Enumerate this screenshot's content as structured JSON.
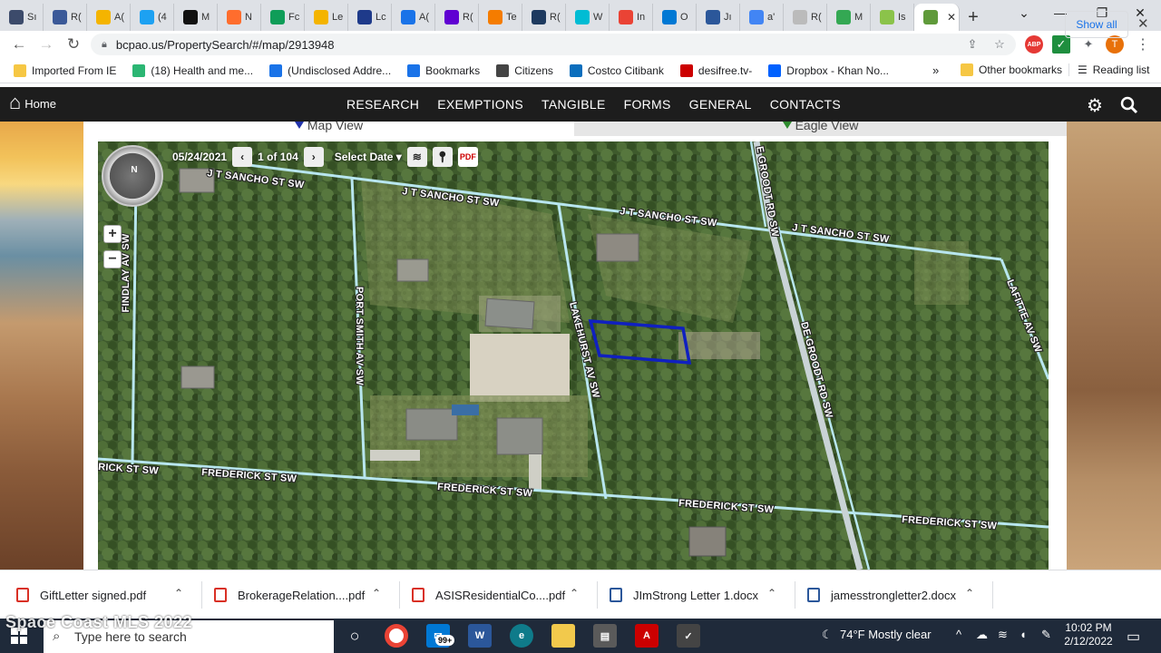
{
  "tabs": [
    {
      "label": "Sı",
      "color": "#3c4b6b"
    },
    {
      "label": "R(",
      "color": "#3b5998"
    },
    {
      "label": "A(",
      "color": "#f4b400"
    },
    {
      "label": "(4",
      "color": "#1da1f2"
    },
    {
      "label": "M",
      "color": "#111111"
    },
    {
      "label": "N",
      "color": "#ff6d2d"
    },
    {
      "label": "Fc",
      "color": "#0f9d58"
    },
    {
      "label": "Le",
      "color": "#f4b400"
    },
    {
      "label": "Lc",
      "color": "#1e3a8a"
    },
    {
      "label": "A(",
      "color": "#1a73e8"
    },
    {
      "label": "R(",
      "color": "#6001d2"
    },
    {
      "label": "Te",
      "color": "#f57c00"
    },
    {
      "label": "R(",
      "color": "#1e3a5f"
    },
    {
      "label": "W",
      "color": "#00bcd4"
    },
    {
      "label": "In",
      "color": "#ea4335"
    },
    {
      "label": "O",
      "color": "#0078d4"
    },
    {
      "label": "Jı",
      "color": "#2b579a"
    },
    {
      "label": "a'",
      "color": "#4285f4"
    },
    {
      "label": "R(",
      "color": "#bbbbbb"
    },
    {
      "label": "M",
      "color": "#34a853"
    },
    {
      "label": "Is",
      "color": "#8bc34a"
    },
    {
      "label": "",
      "color": "#5f9a3a"
    }
  ],
  "address": {
    "url": "bcpao.us/PropertySearch/#/map/2913948"
  },
  "profile_initial": "T",
  "bookmarks": [
    {
      "label": "Imported From IE",
      "color": "#f6c744"
    },
    {
      "label": "(18) Health and me...",
      "color": "#2bb673"
    },
    {
      "label": "(Undisclosed Addre...",
      "color": "#1a73e8"
    },
    {
      "label": "Bookmarks",
      "color": "#1a73e8"
    },
    {
      "label": "Citizens",
      "color": "#444444"
    },
    {
      "label": "Costco Citibank",
      "color": "#0a6ebd"
    },
    {
      "label": "desifree.tv-",
      "color": "#cc0000"
    },
    {
      "label": "Dropbox - Khan No...",
      "color": "#0061fe"
    }
  ],
  "bookmarks_more": "»",
  "other_bookmarks": "Other bookmarks",
  "reading_list": "Reading list",
  "site": {
    "home_label": "Home",
    "menu": [
      "RESEARCH",
      "EXEMPTIONS",
      "TANGIBLE",
      "FORMS",
      "GENERAL",
      "CONTACTS"
    ]
  },
  "view_tabs": {
    "map": "Map View",
    "eagle": "Eagle View"
  },
  "map": {
    "date": "05/24/2021",
    "page": "1 of 104",
    "select_date": "Select Date",
    "compass_label": "N",
    "zoom_in": "+",
    "zoom_out": "−",
    "streets": {
      "jt_sancho_1": "J T SANCHO ST SW",
      "jt_sancho_2": "J T SANCHO ST SW",
      "jt_sancho_3": "J T SANCHO ST SW",
      "jt_sancho_4": "J T SANCHO ST SW",
      "degroodt_1": "E GROODT RD SW",
      "degroodt_2": "DE GROODT RD SW",
      "lafitte": "LAFITTE AV SW",
      "findlay": "FINDLAY AV SW",
      "port_smith": "PORT SMITH AV SW",
      "lakehurst": "LAKEHURST AV SW",
      "frederick_1": "RICK ST SW",
      "frederick_2": "FREDERICK ST SW",
      "frederick_3": "FREDERICK ST SW",
      "frederick_4": "FREDERICK ST SW",
      "frederick_5": "FREDERICK ST SW"
    }
  },
  "downloads": [
    {
      "name": "GiftLetter signed.pdf",
      "type": "pdf"
    },
    {
      "name": "BrokerageRelation....pdf",
      "type": "pdf"
    },
    {
      "name": "ASISResidentialCo....pdf",
      "type": "pdf"
    },
    {
      "name": "JImStrong Letter 1.docx",
      "type": "docx"
    },
    {
      "name": "jamesstrongletter2.docx",
      "type": "docx"
    }
  ],
  "show_all": "Show all",
  "watermark": "Space Coast MLS 2022",
  "taskbar": {
    "search_placeholder": "Type here to search",
    "mail_badge": "99+",
    "weather": "74°F  Mostly clear",
    "time": "10:02 PM",
    "date": "2/12/2022"
  }
}
